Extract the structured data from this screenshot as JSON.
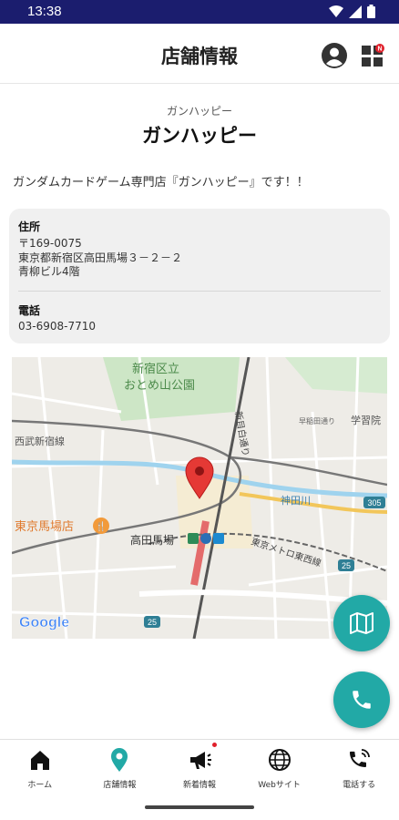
{
  "status_bar": {
    "time": "13:38"
  },
  "header": {
    "title": "店舗情報",
    "badge": "N"
  },
  "store": {
    "kana": "ガンハッピー",
    "name": "ガンハッピー",
    "description": "ガンダムカードゲーム専門店『ガンハッピー』です！！"
  },
  "info_card": {
    "address_label": "住所",
    "address_lines": [
      "〒169-0075",
      "東京都新宿区高田馬場３－２－２",
      "青柳ビル4階"
    ],
    "phone_label": "電話",
    "phone": "03-6908-7710"
  },
  "map": {
    "labels": {
      "park": "新宿区立\nおとめ山公園",
      "park_line1": "新宿区立",
      "park_line2": "おとめ山公園",
      "seibu": "西武新宿線",
      "shop": "東京馬場店",
      "station": "高田馬場",
      "river": "神田川",
      "tozai": "東京メトロ東西線",
      "road_shin": "新目白通り",
      "gakushu": "学習院",
      "waseda": "早稲田通り",
      "route_25": "25",
      "route_305": "305",
      "google": "Google"
    },
    "marker_color": "#e53935"
  },
  "fabs": {
    "map_icon": "map-icon",
    "phone_icon": "phone-icon",
    "color": "#22a9a6"
  },
  "bottom_nav": [
    {
      "label": "ホーム",
      "icon": "home-icon",
      "active": false
    },
    {
      "label": "店舗情報",
      "icon": "location-pin-icon",
      "active": true
    },
    {
      "label": "新着情報",
      "icon": "megaphone-icon",
      "active": false
    },
    {
      "label": "Webサイト",
      "icon": "globe-icon",
      "active": false
    },
    {
      "label": "電話する",
      "icon": "phone-ring-icon",
      "active": false
    }
  ]
}
